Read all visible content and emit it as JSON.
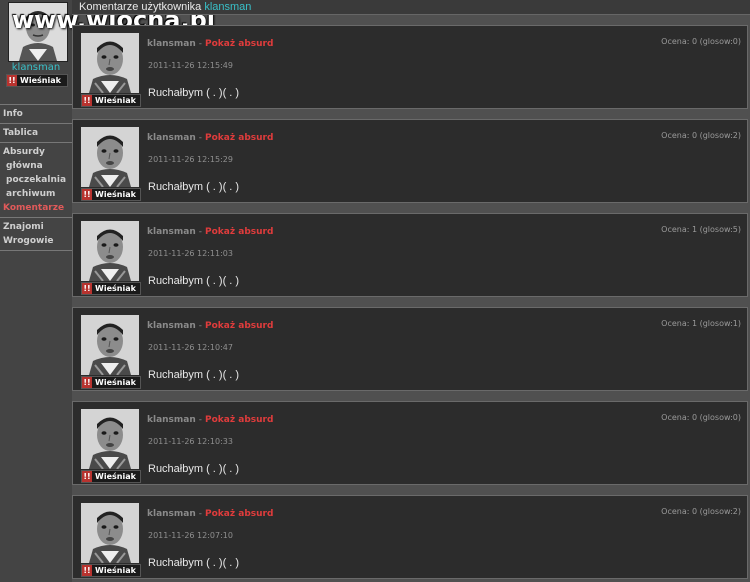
{
  "watermark": "www.wiocha.pl",
  "header": {
    "title_prefix": "Komentarze użytkownika",
    "username": "klansman"
  },
  "profile": {
    "name": "klansman",
    "rank": "Wieśniak"
  },
  "nav": {
    "info": "Info",
    "tablica": "Tablica",
    "absurdy": "Absurdy",
    "glowna": "główna",
    "poczekalnia": "poczekalnia",
    "archiwum": "archiwum",
    "komentarze": "Komentarze",
    "znajomi": "Znajomi",
    "wrogowie": "Wrogowie"
  },
  "comments": [
    {
      "author": "klansman",
      "sep": "-",
      "link": "Pokaż absurd",
      "date": "2011-11-26 12:15:49",
      "text": "Ruchałbym ( . )( . )",
      "score": "Ocena: 0 (glosow:0)",
      "rank": "Wieśniak"
    },
    {
      "author": "klansman",
      "sep": "-",
      "link": "Pokaż absurd",
      "date": "2011-11-26 12:15:29",
      "text": "Ruchałbym ( . )( . )",
      "score": "Ocena: 0 (glosow:2)",
      "rank": "Wieśniak"
    },
    {
      "author": "klansman",
      "sep": "-",
      "link": "Pokaż absurd",
      "date": "2011-11-26 12:11:03",
      "text": "Ruchałbym ( . )( . )",
      "score": "Ocena: 1 (glosow:5)",
      "rank": "Wieśniak"
    },
    {
      "author": "klansman",
      "sep": "-",
      "link": "Pokaż absurd",
      "date": "2011-11-26 12:10:47",
      "text": "Ruchałbym ( . )( . )",
      "score": "Ocena: 1 (glosow:1)",
      "rank": "Wieśniak"
    },
    {
      "author": "klansman",
      "sep": "-",
      "link": "Pokaż absurd",
      "date": "2011-11-26 12:10:33",
      "text": "Ruchałbym ( . )( . )",
      "score": "Ocena: 0 (glosow:0)",
      "rank": "Wieśniak"
    },
    {
      "author": "klansman",
      "sep": "-",
      "link": "Pokaż absurd",
      "date": "2011-11-26 12:07:10",
      "text": "Ruchałbym ( . )( . )",
      "score": "Ocena: 0 (glosow:2)",
      "rank": "Wieśniak"
    }
  ]
}
